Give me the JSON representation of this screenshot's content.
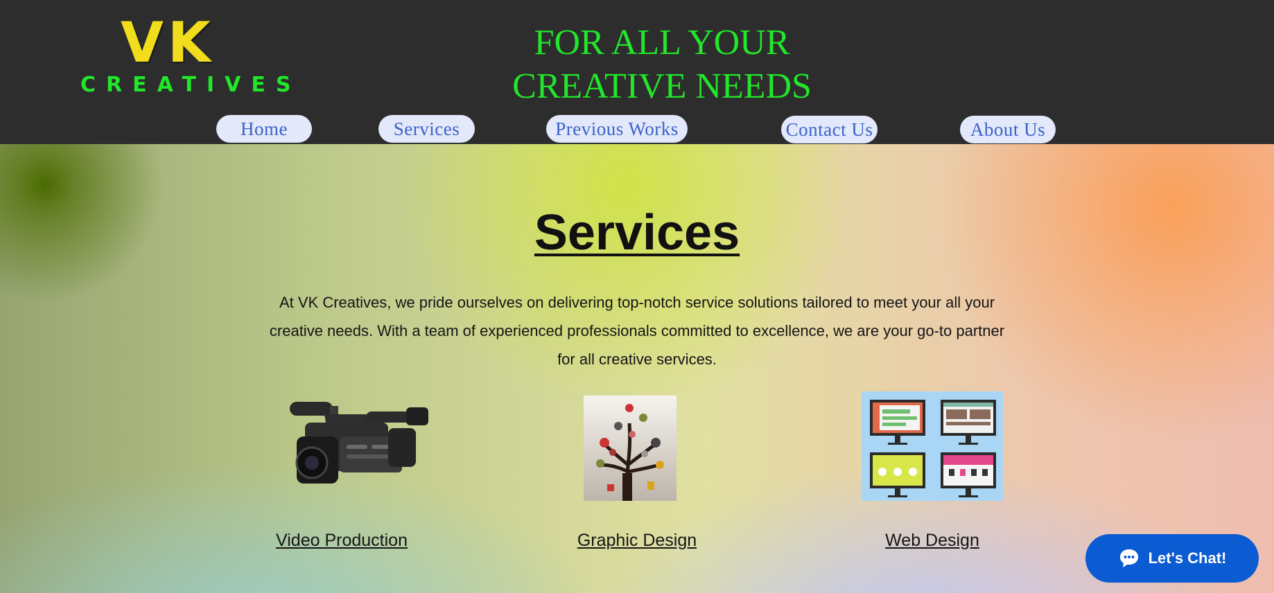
{
  "header": {
    "logo_main": "VK",
    "logo_sub": "CREATIVES",
    "tagline_line1": "FOR ALL YOUR",
    "tagline_line2": "CREATIVE NEEDS"
  },
  "nav": {
    "items": [
      {
        "label": "Home"
      },
      {
        "label": "Services"
      },
      {
        "label": "Previous Works"
      },
      {
        "label": "Contact Us"
      },
      {
        "label": "About Us"
      }
    ]
  },
  "main": {
    "title": "Services",
    "intro": "At VK Creatives, we pride ourselves on delivering top-notch service solutions tailored to meet your all your creative needs. With a team of experienced professionals committed to excellence, we are your go-to partner for all creative services.",
    "services": [
      {
        "label": "Video Production",
        "icon": "video-camera-icon"
      },
      {
        "label": "Graphic Design",
        "icon": "icon-tree-icon"
      },
      {
        "label": "Web Design",
        "icon": "web-monitors-icon"
      }
    ]
  },
  "chat": {
    "label": "Let's Chat!",
    "icon": "chat-bubble-icon"
  },
  "colors": {
    "header_bg": "#2d2d2d",
    "logo_yellow": "#f1dd1b",
    "accent_green": "#22e62a",
    "nav_pill": "#e3e8fb",
    "nav_text": "#3b63c8",
    "chat_blue": "#0b5bd3"
  }
}
